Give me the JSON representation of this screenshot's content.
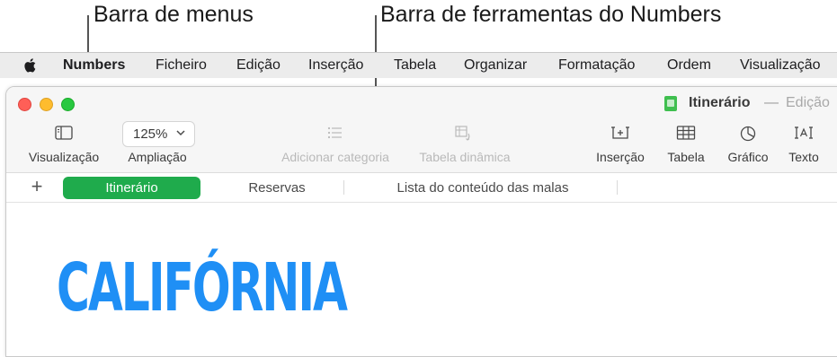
{
  "callouts": {
    "menu_bar": "Barra de menus",
    "toolbar": "Barra de ferramentas do Numbers"
  },
  "menubar": {
    "apple": "apple-icon",
    "items": [
      "Numbers",
      "Ficheiro",
      "Edição",
      "Inserção",
      "Tabela",
      "Organizar",
      "Formatação",
      "Ordem",
      "Visualização"
    ]
  },
  "window": {
    "doc_title": "Itinerário",
    "separator": "—",
    "edited_label": "Edição"
  },
  "toolbar": {
    "view": "Visualização",
    "zoom_label": "Ampliação",
    "zoom_value": "125%",
    "add_category": "Adicionar categoria",
    "pivot_table": "Tabela dinâmica",
    "insert": "Inserção",
    "table": "Tabela",
    "chart": "Gráfico",
    "text": "Texto"
  },
  "sheets": {
    "add": "+",
    "tabs": [
      "Itinerário",
      "Reservas",
      "Lista do conteúdo das malas"
    ],
    "active_index": 0
  },
  "canvas": {
    "title": "CALIFÓRNIA"
  },
  "colors": {
    "accent_tab": "#1fab4c",
    "title_blue": "#1f8ff5"
  }
}
